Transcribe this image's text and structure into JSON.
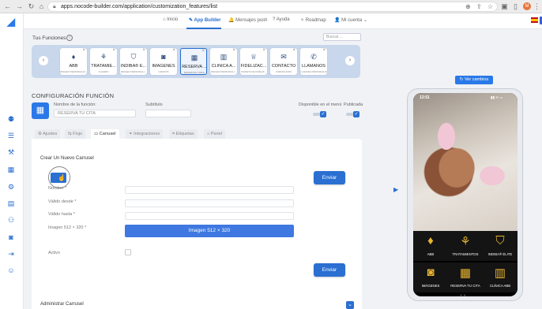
{
  "browser": {
    "url": "apps.nocode-builder.com/application/customization_features/list",
    "profile_initial": "M"
  },
  "topnav": {
    "items": [
      {
        "icon": "⌂",
        "label": "Inicio"
      },
      {
        "icon": "✎",
        "label": "App Builder"
      },
      {
        "icon": "🔔",
        "label": "Mensajes push"
      },
      {
        "icon": "?",
        "label": "Ayuda"
      },
      {
        "icon": "✧",
        "label": "Roadmap"
      },
      {
        "icon": "👤",
        "label": "Mi cuenta ⌄"
      }
    ],
    "lang": "ES"
  },
  "functions": {
    "title": "Tus Funciones",
    "search_placeholder": "Buscar ...",
    "cards": [
      {
        "icon": "♦",
        "label": "ABB",
        "sub": "IMAGEN PERSONALIZ..."
      },
      {
        "icon": "⚘",
        "label": "TRATAMIE...",
        "sub": "CUADRO"
      },
      {
        "icon": "⛉",
        "label": "INDIBA® É...",
        "sub": "IMAGEN PERSONALI..."
      },
      {
        "icon": "◙",
        "label": "IMÁGENES",
        "sub": "GRUPOS"
      },
      {
        "icon": "▦",
        "label": "RESERVA ...",
        "sub": "RESERVAR TABLE",
        "selected": true
      },
      {
        "icon": "▥",
        "label": "CLÍNICA A...",
        "sub": "IMAGEN PERSONALI..."
      },
      {
        "icon": "♕",
        "label": "FIDELIZAC...",
        "sub": "TARJETA DE FIDELIZ..."
      },
      {
        "icon": "✉",
        "label": "CONTACTO",
        "sub": "FORMULARIO"
      },
      {
        "icon": "✆",
        "label": "LLÁMANOS",
        "sub": "LLAMADA PERSONALIZ..."
      }
    ]
  },
  "config": {
    "title": "CONFIGURACIÓN FUNCIÓN",
    "name_label": "Nombre de la función:",
    "name_value": "RESERVA TU CITA",
    "subtitle_label": "Subtítulo",
    "subtitle_value": "",
    "menu_label": "Disponible en el menú",
    "published_label": "Publicada"
  },
  "tabs": [
    {
      "icon": "⚙",
      "label": "Ajustes"
    },
    {
      "icon": "⇆",
      "label": "Flujo"
    },
    {
      "icon": "▭",
      "label": "Carrusel",
      "active": true
    },
    {
      "icon": "⚭",
      "label": "Integraciones"
    },
    {
      "icon": "⌗",
      "label": "Etiquetas"
    },
    {
      "icon": "⌂",
      "label": "Panel"
    }
  ],
  "panel": {
    "title": "Crear Un Nuevo Carrusel",
    "fields": [
      "Nombre *",
      "Válido desde *",
      "Válido hasta *",
      "Imagen 512 × 320 *"
    ],
    "image_button": "Imagen 512 × 320",
    "active_label": "Activo",
    "send_label": "Enviar",
    "admin_title": "Administrar Carrusel"
  },
  "preview": {
    "button": "Ver cambios",
    "status_time": "13:51",
    "status_icons": "▮▮ ≋ ▭",
    "tiles": [
      {
        "icon": "♦",
        "label": "ABB"
      },
      {
        "icon": "⚘",
        "label": "TRATAMIENTOS"
      },
      {
        "icon": "⛉",
        "label": "INDIBA® ÉLITE"
      },
      {
        "icon": "◙",
        "label": "IMÁGENES"
      },
      {
        "icon": "▦",
        "label": "RESERVA TU CITA"
      },
      {
        "icon": "▥",
        "label": "CLÍNICA ABB"
      }
    ]
  },
  "colors": {
    "accent": "#2a6fd1",
    "tile_icon": "#e8b531"
  }
}
